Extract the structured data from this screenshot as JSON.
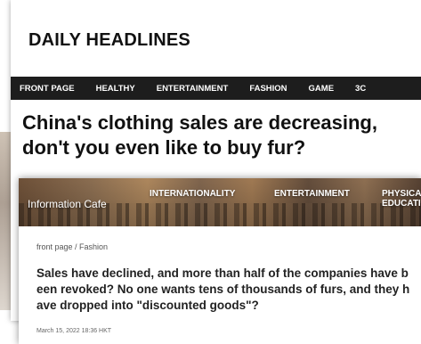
{
  "back_card": {
    "site_title": "DAILY HEADLINES",
    "nav": [
      "FRONT PAGE",
      "HEALTHY",
      "ENTERTAINMENT",
      "FASHION",
      "GAME",
      "3C"
    ],
    "headline_line1": "China's clothing sales are decreasing,",
    "headline_line2": "don't you even like to buy fur?"
  },
  "front_card": {
    "brand": "Information Cafe",
    "nav": [
      "INTERNATIONALITY",
      "ENTERTAINMENT",
      "PHYSICAL",
      "EDUCATION"
    ],
    "breadcrumb": "front page / Fashion",
    "title": "Sales have declined, and more than half of the companies have been revoked? No one wants tens of thousands of furs, and they have dropped into \"discounted goods\"?",
    "timestamp": "March 15, 2022 18:36 HKT"
  }
}
